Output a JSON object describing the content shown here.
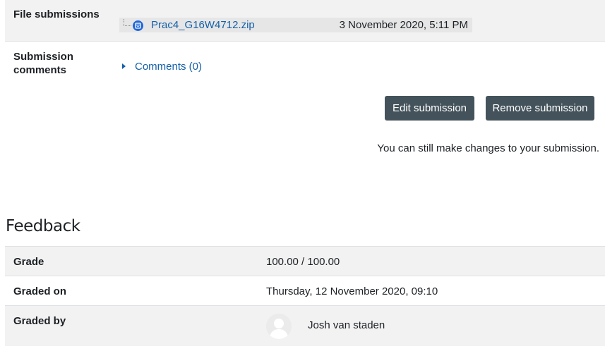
{
  "submission": {
    "file_submissions_label": "File submissions",
    "file_name": "Prac4_G16W4712.zip",
    "file_date": "3 November 2020, 5:11 PM",
    "comments_label": "Submission comments",
    "comments_link": "Comments (0)",
    "edit_button": "Edit submission",
    "remove_button": "Remove submission",
    "note": "You can still make changes to your submission."
  },
  "feedback": {
    "heading": "Feedback",
    "rows": [
      {
        "label": "Grade",
        "value": "100.00 / 100.00"
      },
      {
        "label": "Graded on",
        "value": "Thursday, 12 November 2020, 09:10"
      },
      {
        "label": "Graded by",
        "value": "Josh van staden"
      }
    ]
  },
  "icons": {
    "file": "archive-file-icon",
    "toggle": "caret-right-icon",
    "avatar": "user-avatar-icon"
  },
  "colors": {
    "link": "#1460aa",
    "button_bg": "#44535b",
    "row_shade": "#f2f2f2",
    "file_icon": "#1f66d8"
  }
}
